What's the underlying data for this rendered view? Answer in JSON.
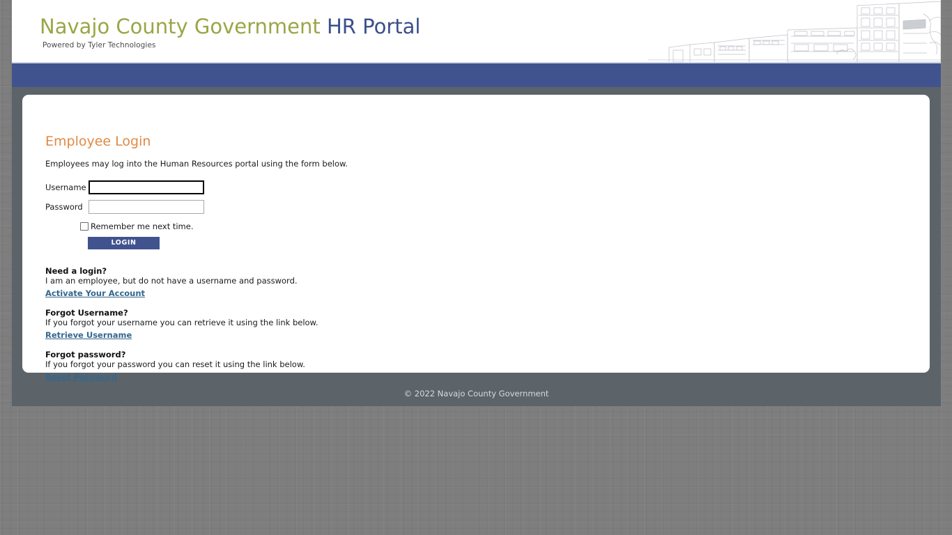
{
  "header": {
    "brand_primary": "Navajo County Government",
    "brand_secondary": "HR Portal",
    "tagline": "Powered by Tyler Technologies",
    "photo_icon": "streetscape-photo"
  },
  "nav": {
    "items": []
  },
  "main": {
    "title": "Employee Login",
    "intro": "Employees may log into the Human Resources portal using the form below.",
    "form": {
      "username_label": "Username",
      "username_value": "",
      "username_placeholder": "",
      "password_label": "Password",
      "password_value": "",
      "password_placeholder": "",
      "remember_label": "Remember me next time.",
      "remember_checked": false,
      "login_label": "LOGIN"
    },
    "help": [
      {
        "heading": "Need a login?",
        "description": "I am an employee, but do not have a username and password.",
        "link": "Activate Your Account"
      },
      {
        "heading": "Forgot Username?",
        "description": "If you forgot your username you can retrieve it using the link below.",
        "link": "Retrieve Username"
      },
      {
        "heading": "Forgot password?",
        "description": "If you forgot your password you can reset it using the link below.",
        "link": "Reset Password"
      }
    ]
  },
  "footer": {
    "copyright": "© 2022 Navajo County Government"
  },
  "colors": {
    "brand_green": "#9aa646",
    "brand_navy": "#3c4f8c",
    "nav_blue": "#41538f",
    "accent_orange": "#e08a45",
    "link_blue": "#33678f",
    "page_slate": "#5c6369",
    "background_gray": "#7e7e7e"
  }
}
